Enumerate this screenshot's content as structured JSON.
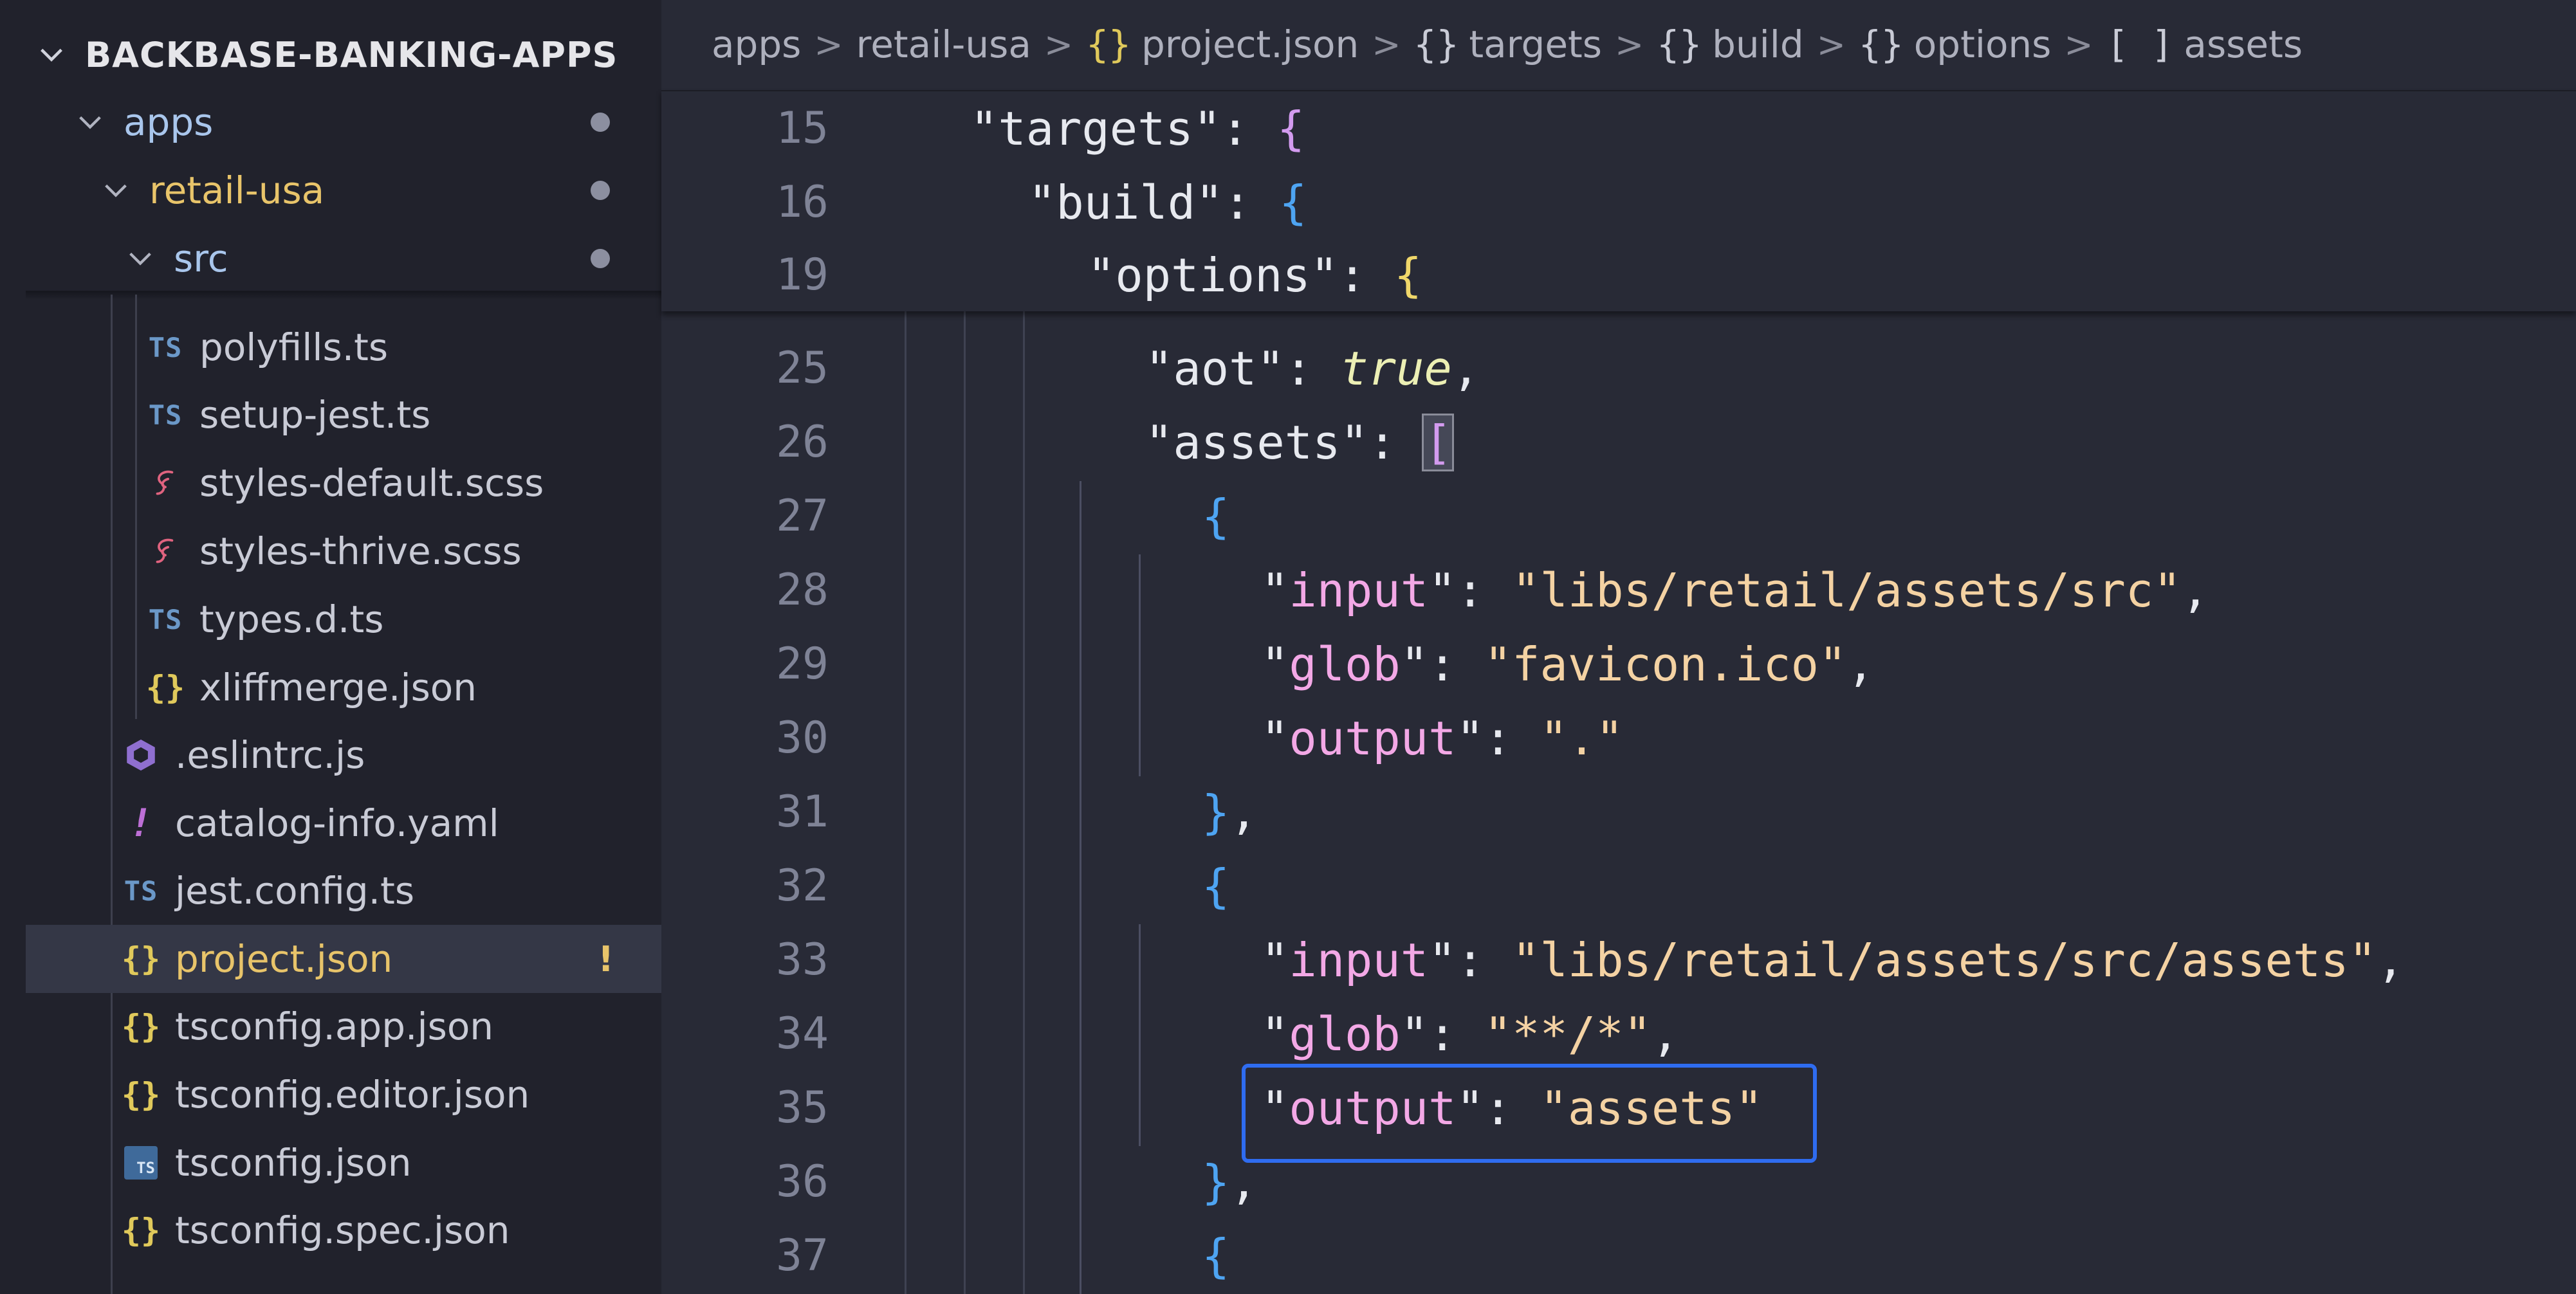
{
  "sidebar": {
    "root_title": "BACKBASE-BANKING-APPS",
    "sticky": [
      {
        "label": "apps",
        "color": "#a9c6ec",
        "modified": true
      },
      {
        "label": "retail-usa",
        "color": "#e8c46a",
        "modified": true
      },
      {
        "label": "src",
        "color": "#a9c6ec",
        "modified": true
      }
    ],
    "files": [
      {
        "icon": "TS",
        "icon_name": "typescript-icon",
        "label": "polyfills.ts"
      },
      {
        "icon": "TS",
        "icon_name": "typescript-icon",
        "label": "setup-jest.ts"
      },
      {
        "icon": "ʂ",
        "icon_name": "sass-icon",
        "label": "styles-default.scss"
      },
      {
        "icon": "ʂ",
        "icon_name": "sass-icon",
        "label": "styles-thrive.scss"
      },
      {
        "icon": "TS",
        "icon_name": "typescript-icon",
        "label": "types.d.ts"
      },
      {
        "icon": "{}",
        "icon_name": "json-icon",
        "label": "xliffmerge.json"
      },
      {
        "icon": "⬢",
        "icon_name": "eslint-icon",
        "label": ".eslintrc.js"
      },
      {
        "icon": "!",
        "icon_name": "yaml-icon",
        "label": "catalog-info.yaml"
      },
      {
        "icon": "TS",
        "icon_name": "typescript-icon",
        "label": "jest.config.ts"
      },
      {
        "icon": "{}",
        "icon_name": "json-icon",
        "label": "project.json",
        "selected": true,
        "status": "!"
      },
      {
        "icon": "{}",
        "icon_name": "json-icon",
        "label": "tsconfig.app.json"
      },
      {
        "icon": "{}",
        "icon_name": "json-icon",
        "label": "tsconfig.editor.json"
      },
      {
        "icon": "TS",
        "icon_name": "tsconfig-icon",
        "label": "tsconfig.json"
      },
      {
        "icon": "{}",
        "icon_name": "json-icon",
        "label": "tsconfig.spec.json"
      }
    ]
  },
  "breadcrumb": {
    "items": [
      {
        "icon": "",
        "label": "apps"
      },
      {
        "icon": "",
        "label": "retail-usa"
      },
      {
        "icon": "{}",
        "label": "project.json"
      },
      {
        "icon": "{}",
        "label": "targets"
      },
      {
        "icon": "{}",
        "label": "build"
      },
      {
        "icon": "{}",
        "label": "options"
      },
      {
        "icon": "[ ]",
        "label": "assets"
      }
    ],
    "separator": ">"
  },
  "editor": {
    "sticky_lines": [
      {
        "num": "15",
        "text": "\"targets\": {"
      },
      {
        "num": "16",
        "text": "\"build\": {"
      },
      {
        "num": "19",
        "text": "\"options\": {"
      }
    ],
    "lines": [
      {
        "num": "25",
        "text": "\"aot\": true,"
      },
      {
        "num": "26",
        "text": "\"assets\": ["
      },
      {
        "num": "27",
        "text": "{"
      },
      {
        "num": "28",
        "text": "\"input\": \"libs/retail/assets/src\","
      },
      {
        "num": "29",
        "text": "\"glob\": \"favicon.ico\","
      },
      {
        "num": "30",
        "text": "\"output\": \".\""
      },
      {
        "num": "31",
        "text": "},"
      },
      {
        "num": "32",
        "text": "{"
      },
      {
        "num": "33",
        "text": "\"input\": \"libs/retail/assets/src/assets\","
      },
      {
        "num": "34",
        "text": "\"glob\": \"**/*\","
      },
      {
        "num": "35",
        "text": "\"output\": \"assets\""
      },
      {
        "num": "36",
        "text": "},"
      },
      {
        "num": "37",
        "text": "{"
      }
    ],
    "highlight_color": "#2f6cf0"
  }
}
